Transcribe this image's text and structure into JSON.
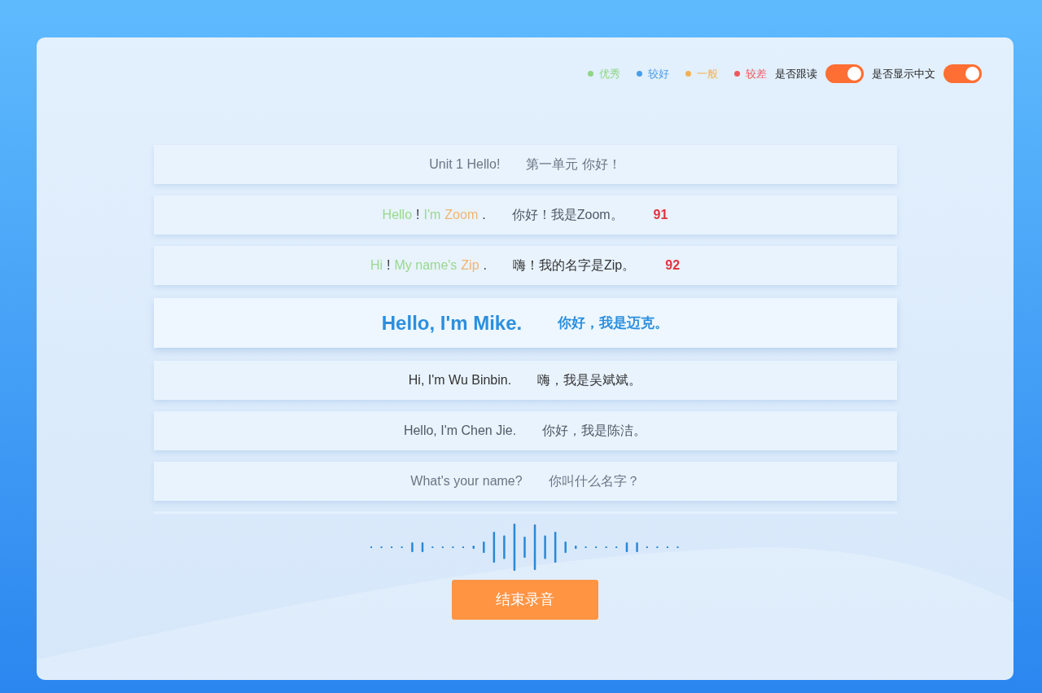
{
  "legend": [
    {
      "label": "优秀",
      "color": "#8fd685"
    },
    {
      "label": "较好",
      "color": "#4a9ee8"
    },
    {
      "label": "一般",
      "color": "#f5b04e"
    },
    {
      "label": "较差",
      "color": "#ea5a5f"
    }
  ],
  "toggles": [
    {
      "label": "是否跟读",
      "on": true
    },
    {
      "label": "是否显示中文",
      "on": true
    }
  ],
  "sentences": [
    {
      "kind": "plain",
      "english": "Unit 1 Hello!",
      "chinese": "第一单元 你好！",
      "selected": false
    },
    {
      "kind": "scored",
      "words": [
        {
          "text": "Hello",
          "color": "#9ad88f"
        },
        {
          "text": "!"
        },
        {
          "text": "I'm",
          "color": "#9ad88f"
        },
        {
          "text": "Zoom",
          "color": "#f5b36e"
        },
        {
          "text": "."
        }
      ],
      "chinese": "你好！我是Zoom。",
      "score": "91",
      "selected": false
    },
    {
      "kind": "scored",
      "words": [
        {
          "text": "Hi",
          "color": "#9ad88f"
        },
        {
          "text": "!"
        },
        {
          "text": "My name's",
          "color": "#9ad88f"
        },
        {
          "text": "Zip",
          "color": "#f5b36e"
        },
        {
          "text": "."
        }
      ],
      "chinese": "嗨！我的名字是Zip。",
      "score": "92",
      "selected": false
    },
    {
      "kind": "plain",
      "english": "Hello, I'm Mike.",
      "chinese": "你好，我是迈克。",
      "selected": true
    },
    {
      "kind": "plain",
      "english": "Hi, I'm Wu Binbin.",
      "chinese": "嗨，我是吴斌斌。",
      "selected": false
    },
    {
      "kind": "plain",
      "english": "Hello, I'm Chen Jie.",
      "chinese": "你好，我是陈洁。",
      "selected": false
    },
    {
      "kind": "plain",
      "english": "What's your name?",
      "chinese": "你叫什么名字？",
      "selected": false
    }
  ],
  "record_button": {
    "label": "结束录音"
  }
}
